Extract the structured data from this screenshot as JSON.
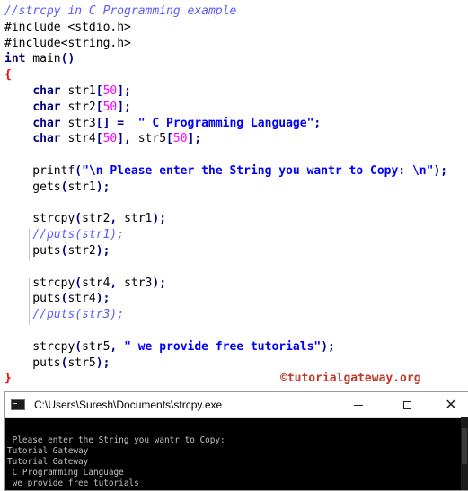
{
  "editor": {
    "lines": [
      [
        {
          "t": "//strcpy in C Programming example",
          "c": "cmt"
        }
      ],
      [
        {
          "t": "#include <stdio.h>",
          "c": ""
        }
      ],
      [
        {
          "t": "#include<string.h>",
          "c": ""
        }
      ],
      [
        {
          "t": "int",
          "c": "kw"
        },
        {
          "t": " main",
          "c": ""
        },
        {
          "t": "()",
          "c": "op"
        }
      ],
      [
        {
          "t": "{",
          "c": "brace"
        }
      ],
      [
        {
          "t": "    ",
          "c": ""
        },
        {
          "t": "char",
          "c": "kw"
        },
        {
          "t": " str1",
          "c": ""
        },
        {
          "t": "[",
          "c": "op"
        },
        {
          "t": "50",
          "c": "num"
        },
        {
          "t": "];",
          "c": "op"
        }
      ],
      [
        {
          "t": "    ",
          "c": ""
        },
        {
          "t": "char",
          "c": "kw"
        },
        {
          "t": " str2",
          "c": ""
        },
        {
          "t": "[",
          "c": "op"
        },
        {
          "t": "50",
          "c": "num"
        },
        {
          "t": "];",
          "c": "op"
        }
      ],
      [
        {
          "t": "    ",
          "c": ""
        },
        {
          "t": "char",
          "c": "kw"
        },
        {
          "t": " str3",
          "c": ""
        },
        {
          "t": "[] =",
          "c": "op"
        },
        {
          "t": "  ",
          "c": ""
        },
        {
          "t": "\" C Programming Language\"",
          "c": "str"
        },
        {
          "t": ";",
          "c": "op"
        }
      ],
      [
        {
          "t": "    ",
          "c": ""
        },
        {
          "t": "char",
          "c": "kw"
        },
        {
          "t": " str4",
          "c": ""
        },
        {
          "t": "[",
          "c": "op"
        },
        {
          "t": "50",
          "c": "num"
        },
        {
          "t": "],",
          "c": "op"
        },
        {
          "t": " str5",
          "c": ""
        },
        {
          "t": "[",
          "c": "op"
        },
        {
          "t": "50",
          "c": "num"
        },
        {
          "t": "];",
          "c": "op"
        }
      ],
      [
        {
          "t": "",
          "c": ""
        }
      ],
      [
        {
          "t": "    printf",
          "c": ""
        },
        {
          "t": "(",
          "c": "op"
        },
        {
          "t": "\"\\n Please enter the String you wantr to Copy: \\n\"",
          "c": "str"
        },
        {
          "t": ");",
          "c": "op"
        }
      ],
      [
        {
          "t": "    gets",
          "c": ""
        },
        {
          "t": "(",
          "c": "op"
        },
        {
          "t": "str1",
          "c": ""
        },
        {
          "t": ");",
          "c": "op"
        }
      ],
      [
        {
          "t": "",
          "c": ""
        }
      ],
      [
        {
          "t": "    strcpy",
          "c": ""
        },
        {
          "t": "(",
          "c": "op"
        },
        {
          "t": "str2",
          "c": ""
        },
        {
          "t": ",",
          "c": "op"
        },
        {
          "t": " str1",
          "c": ""
        },
        {
          "t": ");",
          "c": "op"
        }
      ],
      [
        {
          "t": "    ",
          "c": ""
        },
        {
          "t": "//puts(str1);",
          "c": "cmt"
        }
      ],
      [
        {
          "t": "    puts",
          "c": ""
        },
        {
          "t": "(",
          "c": "op"
        },
        {
          "t": "str2",
          "c": ""
        },
        {
          "t": ");",
          "c": "op"
        }
      ],
      [
        {
          "t": "",
          "c": ""
        }
      ],
      [
        {
          "t": "    strcpy",
          "c": ""
        },
        {
          "t": "(",
          "c": "op"
        },
        {
          "t": "str4",
          "c": ""
        },
        {
          "t": ",",
          "c": "op"
        },
        {
          "t": " str3",
          "c": ""
        },
        {
          "t": ");",
          "c": "op"
        }
      ],
      [
        {
          "t": "    puts",
          "c": ""
        },
        {
          "t": "(",
          "c": "op"
        },
        {
          "t": "str4",
          "c": ""
        },
        {
          "t": ");",
          "c": "op"
        }
      ],
      [
        {
          "t": "    ",
          "c": ""
        },
        {
          "t": "//puts(str3);",
          "c": "cmt"
        }
      ],
      [
        {
          "t": "",
          "c": ""
        }
      ],
      [
        {
          "t": "    strcpy",
          "c": ""
        },
        {
          "t": "(",
          "c": "op"
        },
        {
          "t": "str5",
          "c": ""
        },
        {
          "t": ",",
          "c": "op"
        },
        {
          "t": " ",
          "c": ""
        },
        {
          "t": "\" we provide free tutorials\"",
          "c": "str"
        },
        {
          "t": ");",
          "c": "op"
        }
      ],
      [
        {
          "t": "    puts",
          "c": ""
        },
        {
          "t": "(",
          "c": "op"
        },
        {
          "t": "str5",
          "c": ""
        },
        {
          "t": ");",
          "c": "op"
        }
      ],
      [
        {
          "t": "}",
          "c": "brace"
        }
      ]
    ],
    "watermark": "©tutorialgateway.org"
  },
  "console": {
    "title": "C:\\Users\\Suresh\\Documents\\strcpy.exe",
    "minimize_label": "—",
    "maximize_label": "☐",
    "close_label": "✕",
    "output_lines": [
      "",
      " Please enter the String you wantr to Copy:",
      "Tutorial Gateway",
      "Tutorial Gateway",
      " C Programming Language",
      " we provide free tutorials"
    ]
  },
  "colors": {
    "keyword": "#000080",
    "string": "#0000ff",
    "number": "#ff00ff",
    "comment": "#5b5bff",
    "brace": "#ff0000",
    "watermark": "#c0392b",
    "console_bg": "#000000",
    "console_text": "#c0c0c0"
  }
}
